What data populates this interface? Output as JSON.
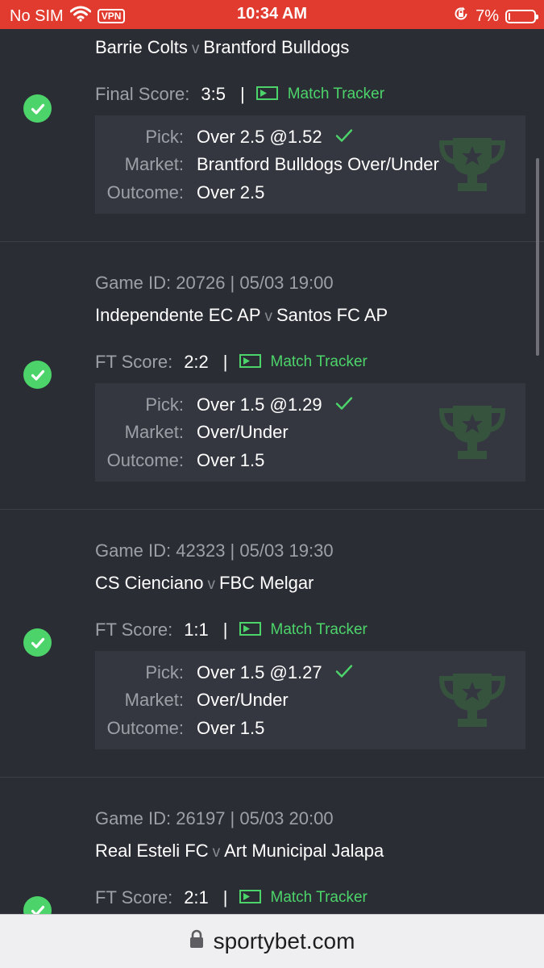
{
  "status_bar": {
    "carrier": "No SIM",
    "vpn": "VPN",
    "time": "10:34 AM",
    "battery": "7%",
    "battery_level": 0.07
  },
  "labels": {
    "pick": "Pick:",
    "market": "Market:",
    "outcome": "Outcome:",
    "match_tracker": "Match Tracker",
    "vs": "v"
  },
  "bets": [
    {
      "game_id": "",
      "home": "Barrie Colts",
      "away": "Brantford Bulldogs",
      "score_label": "Final Score:",
      "score": "3:5",
      "pick": "Over 2.5 @1.52",
      "market": "Brantford Bulldogs Over/Under",
      "outcome": "Over 2.5"
    },
    {
      "game_id": "Game ID: 20726 | 05/03 19:00",
      "home": "Independente EC AP",
      "away": "Santos FC AP",
      "score_label": "FT Score:",
      "score": "2:2",
      "pick": "Over 1.5 @1.29",
      "market": "Over/Under",
      "outcome": "Over 1.5"
    },
    {
      "game_id": "Game ID: 42323 | 05/03 19:30",
      "home": "CS Cienciano",
      "away": "FBC Melgar",
      "score_label": "FT Score:",
      "score": "1:1",
      "pick": "Over 1.5 @1.27",
      "market": "Over/Under",
      "outcome": "Over 1.5"
    },
    {
      "game_id": "Game ID: 26197 | 05/03 20:00",
      "home": "Real Esteli FC",
      "away": "Art Municipal Jalapa",
      "score_label": "FT Score:",
      "score": "2:1",
      "pick": "",
      "market": "",
      "outcome": ""
    }
  ],
  "url_bar": {
    "domain": "sportybet.com"
  },
  "colors": {
    "background": "#2b2d35",
    "card": "#353740",
    "win_green": "#4cd46a",
    "status_red": "#e13b2f"
  }
}
